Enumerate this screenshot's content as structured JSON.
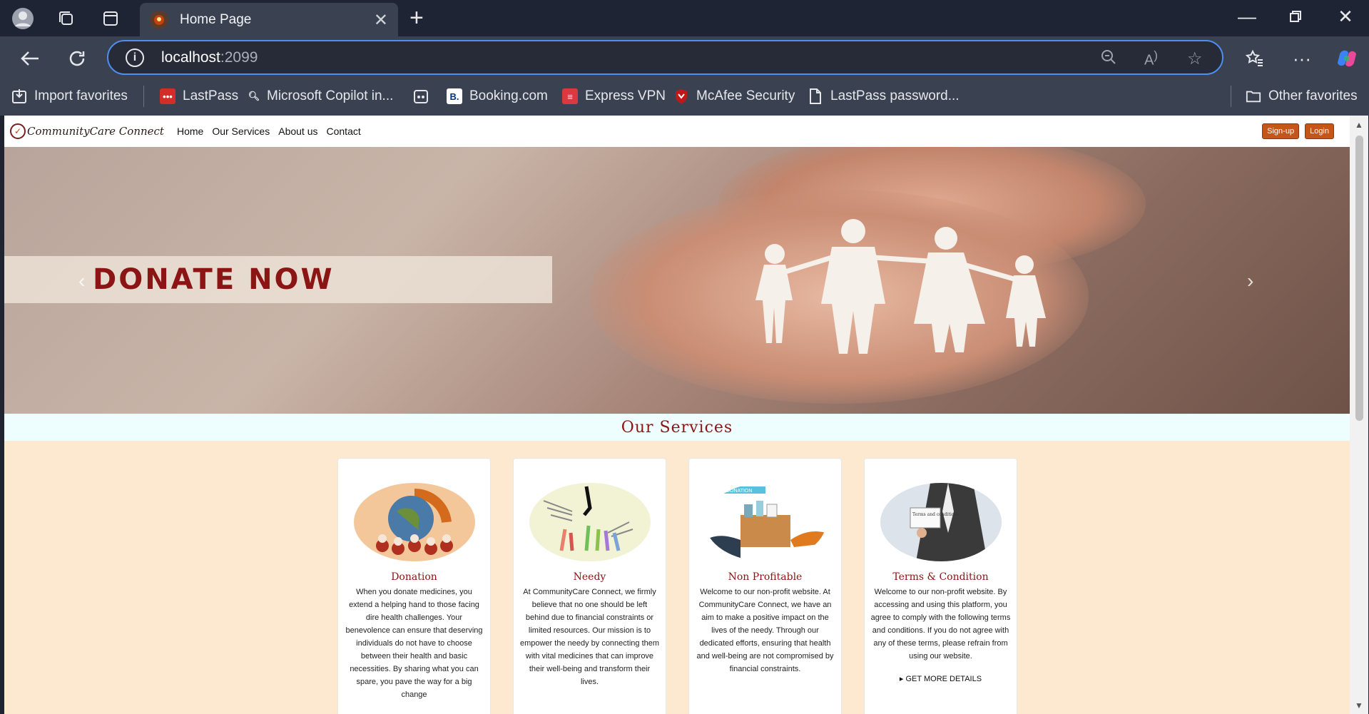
{
  "browser": {
    "tab_title": "Home Page",
    "url_host": "localhost",
    "url_port": ":2099",
    "bookmarks": [
      {
        "label": "Import favorites"
      },
      {
        "label": "LastPass"
      },
      {
        "label": "Microsoft Copilot in..."
      },
      {
        "label": "Booking.com"
      },
      {
        "label": "Express VPN"
      },
      {
        "label": "McAfee Security"
      },
      {
        "label": "LastPass password..."
      },
      {
        "label": "Other favorites"
      }
    ]
  },
  "site": {
    "logo_text": "CommunityCare Connect",
    "nav": [
      "Home",
      "Our Services",
      "About us",
      "Contact"
    ],
    "signup_label": "Sign-up",
    "login_label": "Login",
    "hero_banner": "DONATE NOW",
    "services_title": "Our Services",
    "cards": [
      {
        "title": "Donation",
        "text": "When you donate medicines, you extend a helping hand to those facing dire health challenges. Your benevolence can ensure that deserving individuals do not have to choose between their health and basic necessities. By sharing what you can spare, you pave the way for a big change"
      },
      {
        "title": "Needy",
        "text": "At CommunityCare Connect, we firmly believe that no one should be left behind due to financial constraints or limited resources. Our mission is to empower the needy by connecting them with vital medicines that can improve their well-being and transform their lives."
      },
      {
        "title": "Non Profitable",
        "text": "Welcome to our non-profit website. At CommunityCare Connect, we have an aim to make a positive impact on the lives of the needy. Through our dedicated efforts, ensuring that health and well-being are not compromised by financial constraints."
      },
      {
        "title": "Terms & Condition",
        "text": "Welcome to our non-profit website. By accessing and using this platform, you agree to comply with the following terms and conditions. If you do not agree with any of these terms, please refrain from using our website.",
        "more": "▸ GET MORE DETAILS",
        "image_text": "Terms and conditions"
      }
    ],
    "donation_image_label": "DONATION"
  }
}
